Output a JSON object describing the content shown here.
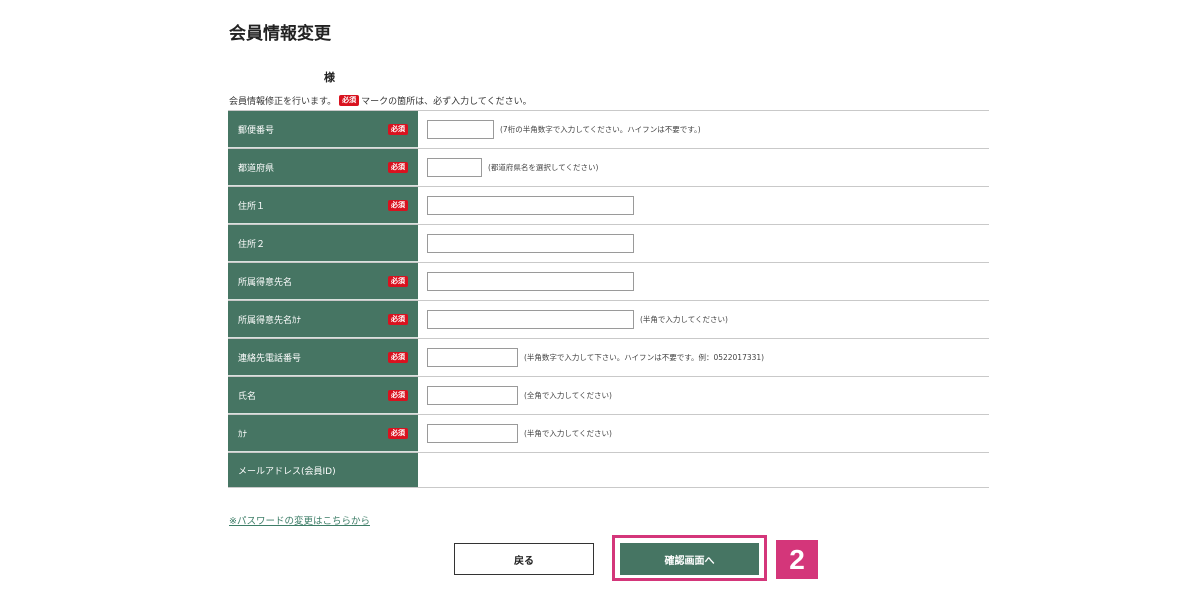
{
  "page": {
    "title": "会員情報変更",
    "honorific": "様",
    "intro_before": "会員情報修正を行います。",
    "intro_after": "マークの箇所は、必ず入力してください。",
    "required_label": "必須"
  },
  "form": {
    "rows": [
      {
        "label": "郵便番号",
        "required": true,
        "value": "",
        "hint": "(7桁の半角数字で入力してください。ハイフンは不要です。)"
      },
      {
        "label": "都道府県",
        "required": true,
        "value": "",
        "hint": "(都道府県名を選択してください)"
      },
      {
        "label": "住所１",
        "required": true,
        "value": "",
        "hint": ""
      },
      {
        "label": "住所２",
        "required": false,
        "value": "",
        "hint": ""
      },
      {
        "label": "所属得意先名",
        "required": true,
        "value": "",
        "hint": ""
      },
      {
        "label": "所属得意先名ｶﾅ",
        "required": true,
        "value": "",
        "hint": "(半角で入力してください)"
      },
      {
        "label": "連絡先電話番号",
        "required": true,
        "value": "",
        "hint": "(半角数字で入力して下さい。ハイフンは不要です。例：0522017331)"
      },
      {
        "label": "氏名",
        "required": true,
        "value": "",
        "hint": "(全角で入力してください)"
      },
      {
        "label": "ｶﾅ",
        "required": true,
        "value": "",
        "hint": "(半角で入力してください)"
      },
      {
        "label": "メールアドレス(会員ID)",
        "required": false,
        "value": "",
        "hint": ""
      }
    ]
  },
  "links": {
    "password_change": "※パスワードの変更はこちらから"
  },
  "buttons": {
    "back": "戻る",
    "confirm": "確認画面へ"
  },
  "annotation": {
    "step_number": "2"
  },
  "colors": {
    "label_bg": "#467563",
    "required_badge": "#d9121f",
    "highlight": "#d4367a",
    "link": "#3d7d67"
  }
}
